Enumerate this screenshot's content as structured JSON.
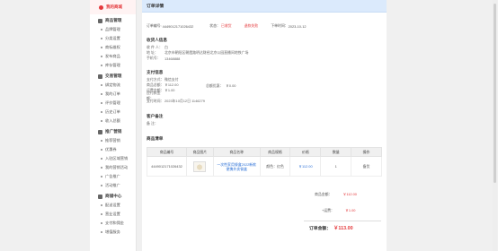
{
  "sidebar": {
    "head": "我的商城",
    "groups": [
      {
        "title": "商品管理",
        "items": [
          "品牌管理",
          "分类设置",
          "商标维权",
          "发布商品",
          "库存管理"
        ]
      },
      {
        "title": "交易管理",
        "items": [
          "绑定物流",
          "我的订单",
          "评价管理",
          "历史订单",
          "收入总额"
        ]
      },
      {
        "title": "推广营销",
        "items": [
          "推荐营销",
          "优惠券",
          "入驻区域营销",
          "我的营销活动",
          "广告推广",
          "活动推广"
        ]
      },
      {
        "title": "商铺中心",
        "items": [
          "配送设置",
          "营业设置",
          "支付和佣金",
          "增值服务"
        ]
      }
    ]
  },
  "title": "订单详情",
  "order": {
    "no_label": "订单编号:",
    "no_value": "4449012171026432",
    "status_label": "状态：",
    "status_value": "已收货",
    "refund": "退款失败",
    "time_label": "下单时间：",
    "time_value": "2023-10-12"
  },
  "receiver": {
    "section": "收货人信息",
    "rows": [
      {
        "k": "收 件 人：",
        "v": "白"
      },
      {
        "k": "地    址：",
        "v": "北京市朝阳区朝霞路明达财经北京公园直播间地铁广场"
      },
      {
        "k": "手机号：",
        "v": "13468888"
      }
    ]
  },
  "payment": {
    "section": "支付信息",
    "rows": [
      {
        "k": "支付方式：",
        "v": "微信支付"
      },
      {
        "k": "商品总额：",
        "v": "￥112.00"
      },
      {
        "k": "运费金额：",
        "v": "￥1.00"
      },
      {
        "k": "应付款金额：",
        "v": ""
      },
      {
        "k": "支付时间：",
        "v": "2023年10月12日 1146279"
      }
    ],
    "discount_label": "总额优惠：",
    "discount_value": "￥0.00"
  },
  "note": {
    "section": "客户备注",
    "label": "备    注："
  },
  "goods": {
    "section": "商品清单",
    "headers": [
      "商品编号",
      "商品图片",
      "商品名称",
      "商品规格",
      "价格",
      "数量",
      "操作"
    ],
    "row": {
      "code": "4449012171026432",
      "name": "一次性家用餐盒2022新款便携外卖餐盒",
      "spec": "颜色：红色",
      "price": "￥112.00",
      "qty": "1",
      "op": "备货"
    }
  },
  "totals": {
    "goods_total_label": "商品金额：",
    "goods_total": "￥112.00",
    "express_label": "+运费：",
    "express": "￥1.00",
    "order_total_label": "订单金额：",
    "order_total": "￥113.00"
  },
  "colors": {
    "accent": "#e4393c",
    "link": "#2a6fd6",
    "header": "#dbeafc"
  }
}
